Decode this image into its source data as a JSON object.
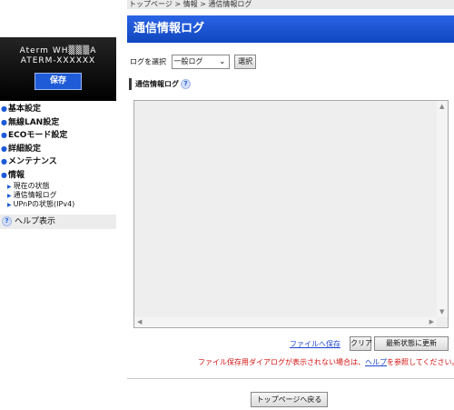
{
  "sidebar": {
    "brand_line1": "Aterm WH▒▒▒A",
    "brand_line2": "ATERM-XXXXXX",
    "save_label": "保存",
    "nav": [
      "基本設定",
      "無線LAN設定",
      "ECOモード設定",
      "詳細設定",
      "メンテナンス",
      "情報"
    ],
    "sub": [
      "現在の状態",
      "通信情報ログ",
      "UPnPの状態(IPv4)"
    ],
    "help_label": "ヘルプ表示"
  },
  "breadcrumb": "トップページ > 情報 > 通信情報ログ",
  "page_title": "通信情報ログ",
  "log_select": {
    "label": "ログを選択",
    "selected": "一般ログ",
    "button": "選択"
  },
  "section_title": "通信情報ログ",
  "log_content": "",
  "actions": {
    "save_file": "ファイルへ保存",
    "clear": "クリア",
    "refresh": "最新状態に更新"
  },
  "note": {
    "before": "ファイル保存用ダイアログが表示されない場合は、",
    "link": "ヘルプ",
    "after": "を参照してください。"
  },
  "back_button": "トップページへ戻る",
  "colors": {
    "accent": "#1d5bd6",
    "title_bar": "#1a52d6",
    "note": "#d41010"
  },
  "icons": {
    "help": "question-icon",
    "nav_bullet": "circle-arrow-icon"
  }
}
